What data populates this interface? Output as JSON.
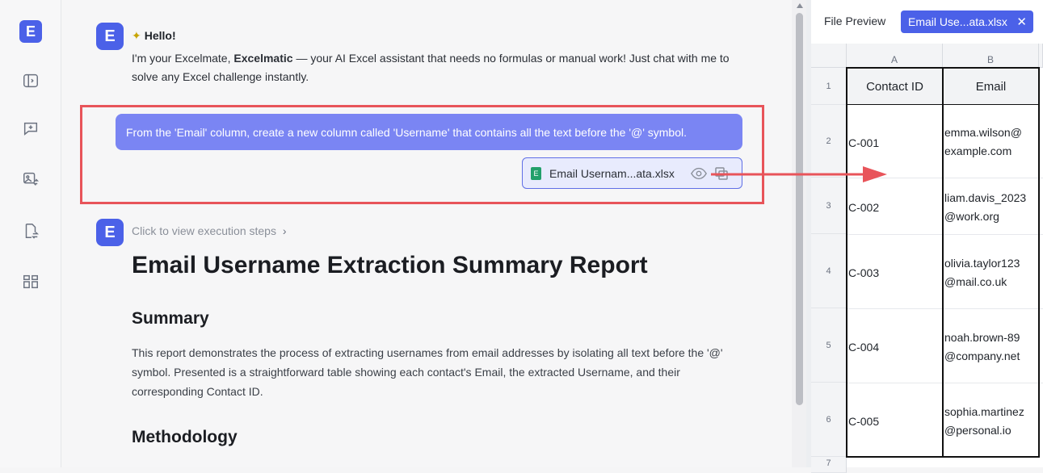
{
  "rail": {
    "logo": "E",
    "icons": [
      "sidebar-toggle-icon",
      "new-chat-icon",
      "image-convert-icon",
      "file-convert-icon",
      "layout-icon"
    ]
  },
  "chat": {
    "avatar_letter": "E",
    "hello_title": "Hello!",
    "hello_body_pre": "I'm your Excelmate, ",
    "hello_body_bold": "Excelmatic",
    "hello_body_post": " — your AI Excel assistant that needs no formulas or manual work! Just chat with me to solve any Excel challenge instantly.",
    "user_message": "From the 'Email' column, create a new column called 'Username' that contains all the text before the '@' symbol.",
    "attachment_name": "Email Usernam...ata.xlsx",
    "steps_link": "Click to view execution steps",
    "report_title": "Email Username Extraction Summary Report",
    "summary_heading": "Summary",
    "summary_text": "This report demonstrates the process of extracting usernames from email addresses by isolating all text before the '@' symbol. Presented is a straightforward table showing each contact's Email, the extracted Username, and their corresponding Contact ID.",
    "methodology_heading": "Methodology"
  },
  "preview": {
    "tab_label": "File Preview",
    "active_file": "Email Use...ata.xlsx",
    "columns": [
      "A",
      "B"
    ],
    "rows": [
      {
        "num": "1",
        "a": "Contact ID",
        "b1": "Email",
        "b2": ""
      },
      {
        "num": "2",
        "a": "C-001",
        "b1": "emma.wilson@",
        "b2": "example.com"
      },
      {
        "num": "3",
        "a": "C-002",
        "b1": "liam.davis_2023",
        "b2": "@work.org"
      },
      {
        "num": "4",
        "a": "C-003",
        "b1": "olivia.taylor123",
        "b2": "@mail.co.uk"
      },
      {
        "num": "5",
        "a": "C-004",
        "b1": "noah.brown-89",
        "b2": "@company.net"
      },
      {
        "num": "6",
        "a": "C-005",
        "b1": "sophia.martinez",
        "b2": "@personal.io"
      },
      {
        "num": "7",
        "a": "",
        "b1": "",
        "b2": ""
      }
    ]
  },
  "colors": {
    "accent": "#4b61e8",
    "highlight": "#e8545a",
    "bubble": "#7a85f3"
  }
}
